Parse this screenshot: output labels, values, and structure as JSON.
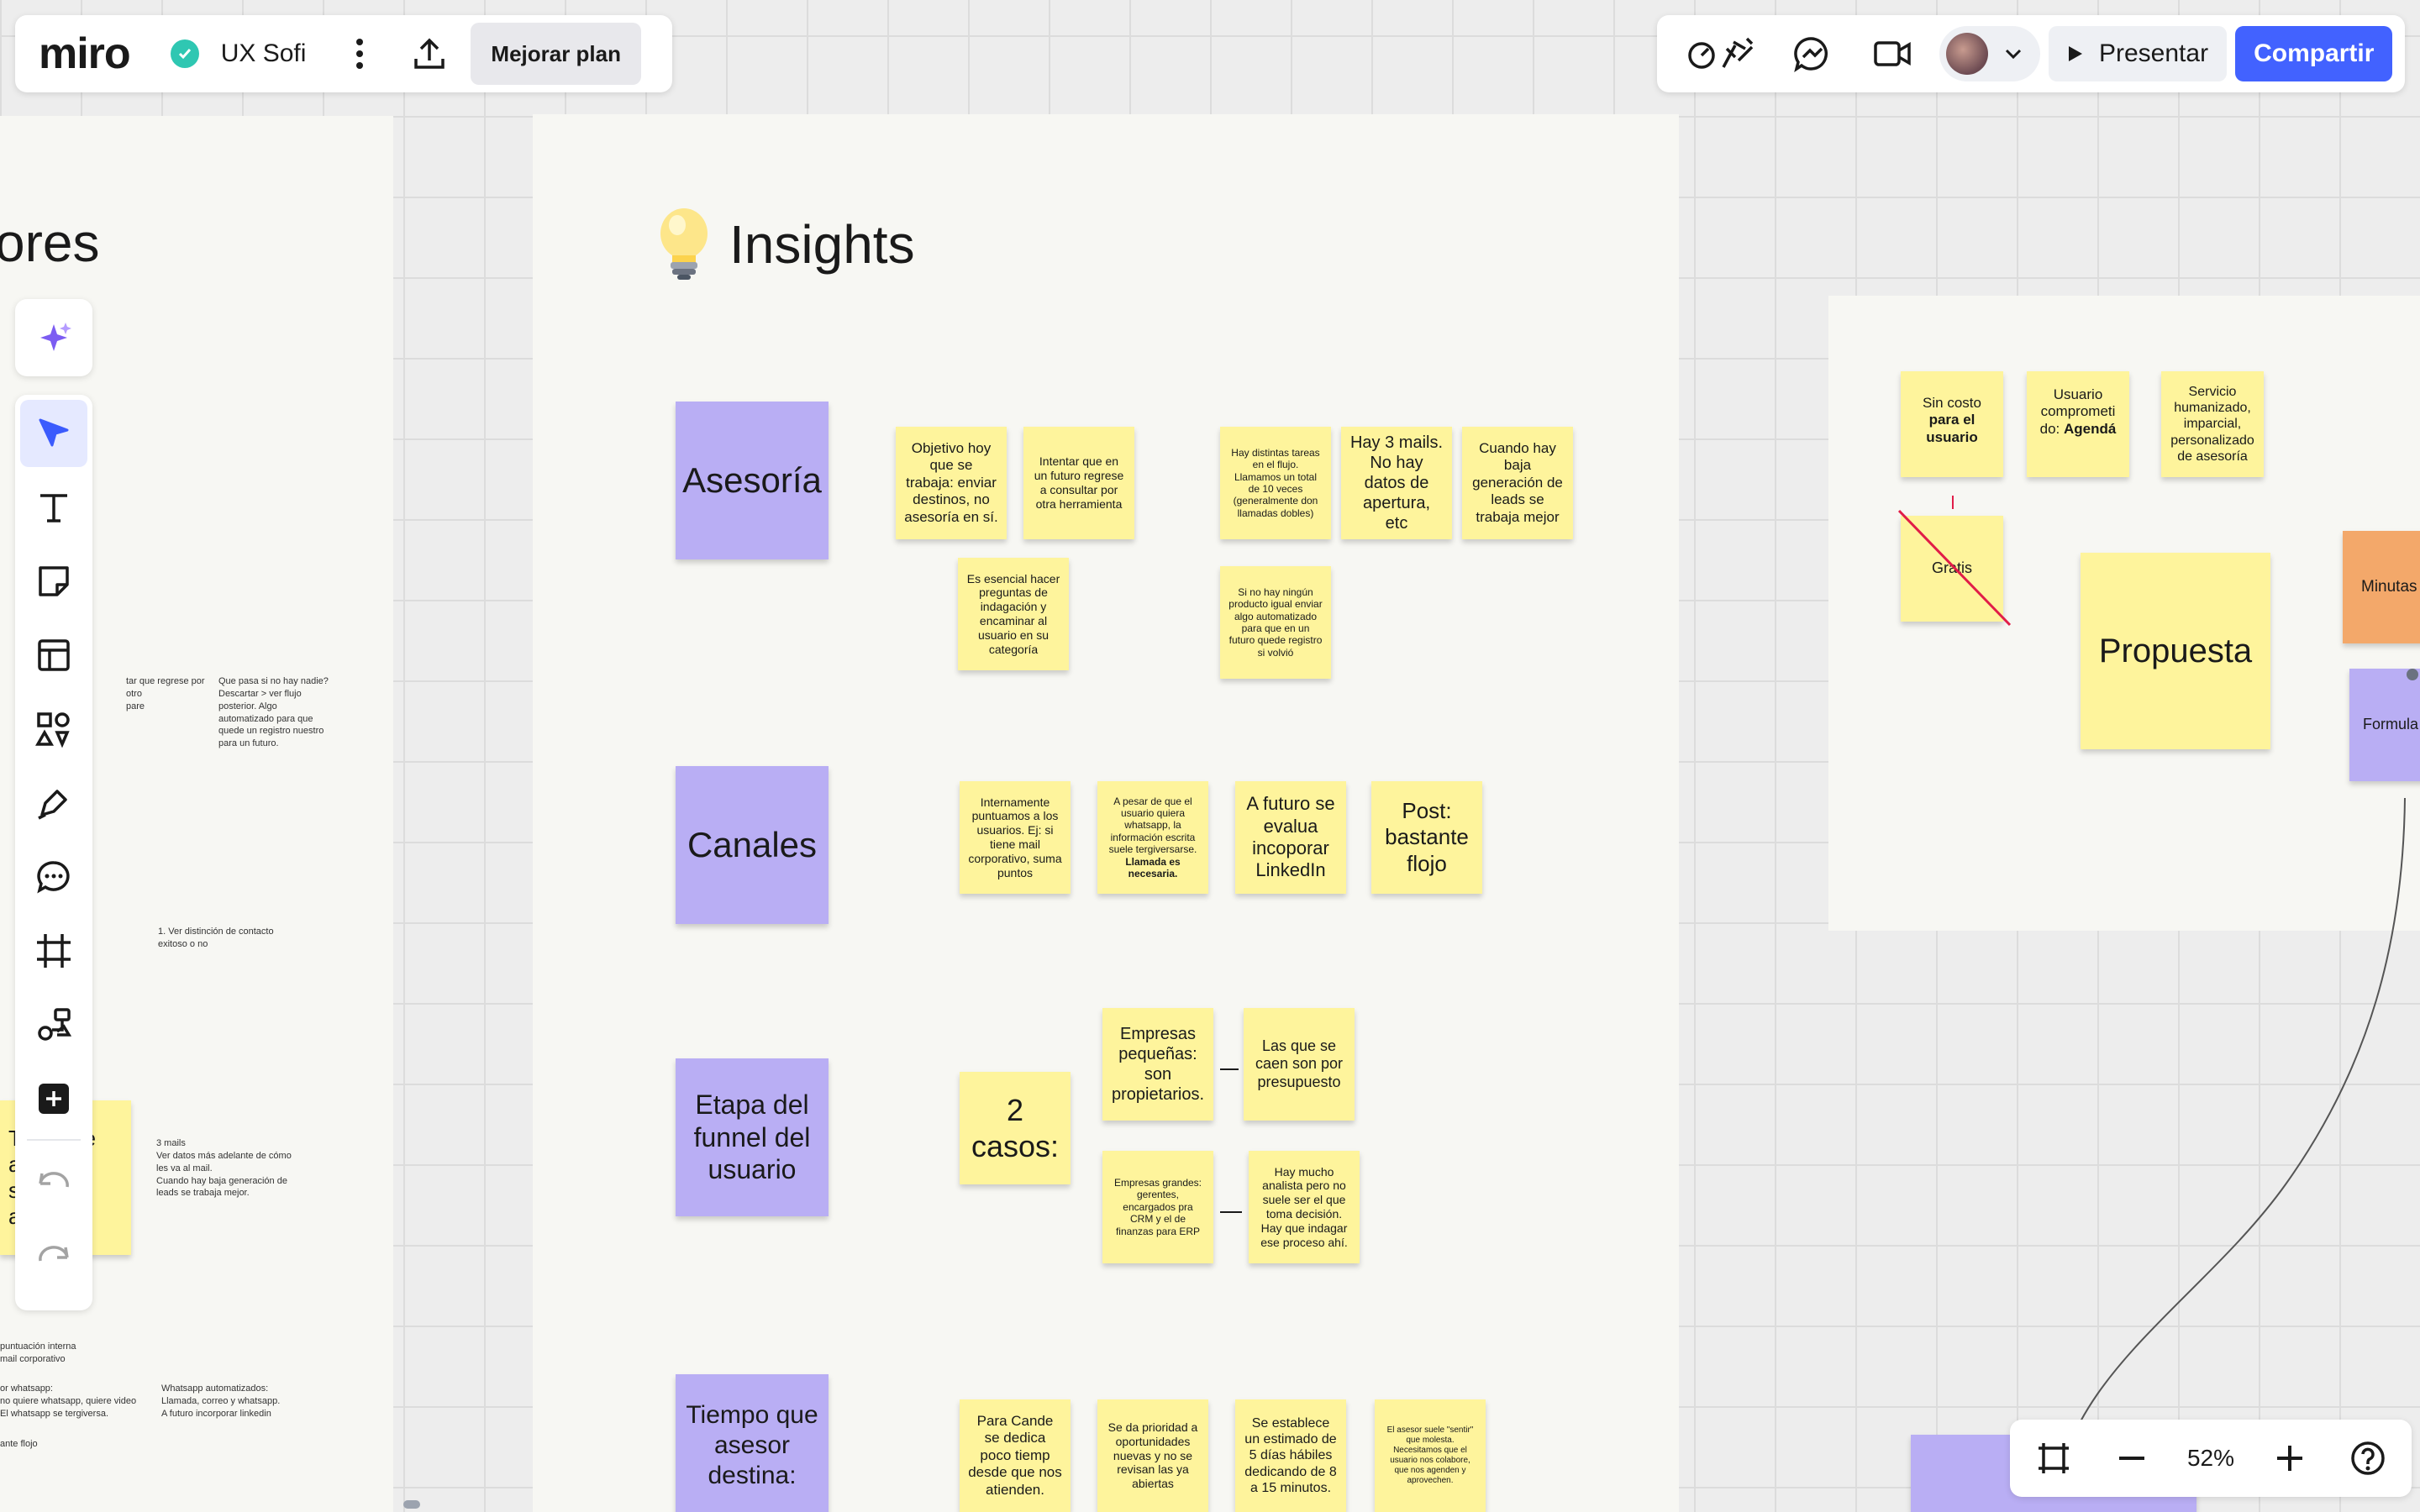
{
  "topbar": {
    "logo": "miro",
    "board_name": "UX Sofi",
    "upgrade_label": "Mejorar plan",
    "present_label": "Presentar",
    "share_label": "Compartir"
  },
  "zoom": {
    "level": "52%"
  },
  "left_frame": {
    "title_fragment": "ores",
    "notes": [
      "Que pasa si no hay nadie?\nDescartar > ver flujo\nposterior. Algo\nautomatizado para que\nquede un registro nuestro\npara un futuro.",
      "tar que regrese por otro\npare",
      "1. Ver distinción de contacto\n   exitoso o no",
      "3 mails\nVer datos más adelante de cómo\nles va al mail.\nCuando hay baja generación de\nleads se trabaja mejor.",
      "Whatsapp automatizados:\nLlamada, correo y whatsapp.\nA futuro incorporar linkedin",
      "puntuación interna\nmail corporativo",
      "or whatsapp:\nno quiere whatsapp, quiere video\nEl whatsapp se tergiversa.",
      "ante flojo"
    ],
    "sticky_fragment": "Tasas de\na       o\nsa      ve\na      ón"
  },
  "insights": {
    "title": "Insights",
    "rows": [
      {
        "label": "Asesoría"
      },
      {
        "label": "Canales"
      },
      {
        "label": "Etapa del funnel del usuario"
      },
      {
        "label": "Tiempo que asesor destina:"
      }
    ],
    "asesoria_notes": [
      "Objetivo hoy que se trabaja: enviar destinos, no asesoría en sí.",
      "Intentar que en un futuro regrese a consultar por otra herramienta",
      "Hay distintas tareas en el flujo. Llamamos un total de 10 veces (generalmente don llamadas dobles)",
      "Hay 3 mails. No hay datos de apertura, etc",
      "Cuando hay baja generación de leads se trabaja mejor",
      "Es esencial hacer preguntas de indagación y encaminar al usuario en su categoría",
      "Si no hay ningún producto igual enviar algo automatizado para que en un futuro quede registro si volvió"
    ],
    "canales_notes": [
      "Internamente puntuamos a los usuarios. Ej: si tiene mail corporativo, suma puntos",
      "A pesar de que el usuario quiera whatsapp, la información escrita suele tergiversarse.",
      "Llamada es necesaria.",
      "A futuro se evalua incoporar LinkedIn",
      "Post: bastante flojo"
    ],
    "funnel_notes": [
      "2 casos:",
      "Empresas pequeñas: son propietarios.",
      "Las que se caen son por presupuesto",
      "Empresas grandes: gerentes, encargados pra CRM y el de finanzas  para ERP",
      "Hay mucho analista pero no suele ser el que toma decisión. Hay que indagar ese proceso ahí."
    ],
    "tiempo_notes": [
      "Para Cande se dedica poco tiemp desde que nos atienden.",
      "Se da prioridad a oportunidades nuevas y no se revisan las ya abiertas",
      "Se establece un estimado de 5 días hábiles dedicando de 8 a 15 minutos.",
      "El asesor suele \"sentir\" que molesta. Necesitamos que el usuario nos colabore, que nos agenden y aprovechen."
    ]
  },
  "right_frame": {
    "notes": [
      {
        "pre": "Sin costo ",
        "bold": "para el usuario"
      },
      {
        "pre": "Usuario comprometi do: ",
        "bold": "Agendá"
      },
      {
        "pre": "Servicio humanizado, imparcial, personalizado de asesoría",
        "bold": ""
      }
    ],
    "gratis": "Gratis",
    "propuesta": "Propuesta",
    "minutas": "Minutas",
    "formula": "Formula"
  },
  "colors": {
    "accent": "#4262ff",
    "sticky_yellow": "#fef49c",
    "sticky_purple": "#b9aef4",
    "sticky_orange": "#f3a86a",
    "board_status": "#22c55e"
  }
}
